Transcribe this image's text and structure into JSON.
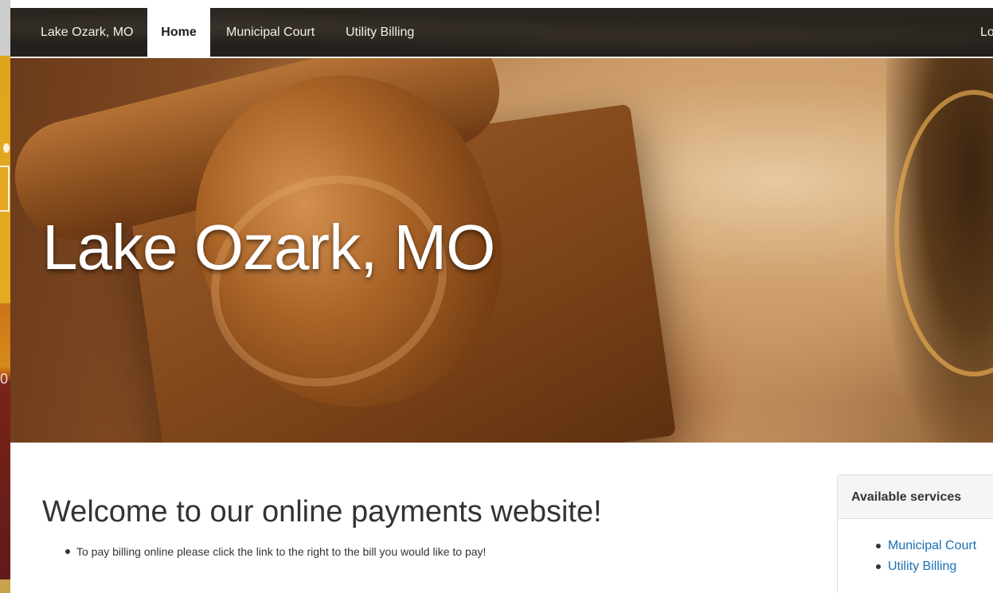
{
  "navbar": {
    "brand": "Lake Ozark, MO",
    "items": [
      {
        "label": "Home",
        "active": true
      },
      {
        "label": "Municipal Court",
        "active": false
      },
      {
        "label": "Utility Billing",
        "active": false
      }
    ],
    "login_partial": "Lo"
  },
  "hero": {
    "title": "Lake Ozark, MO"
  },
  "main": {
    "heading": "Welcome to our online payments website!",
    "bullets": [
      "To pay billing online please click the link to the right to the bill you would like to pay!"
    ]
  },
  "services_panel": {
    "heading": "Available services",
    "links": [
      "Municipal Court",
      "Utility Billing"
    ]
  },
  "colors": {
    "navbar_bg": "#241f1b",
    "link": "#1a6fb3",
    "text": "#333333"
  }
}
